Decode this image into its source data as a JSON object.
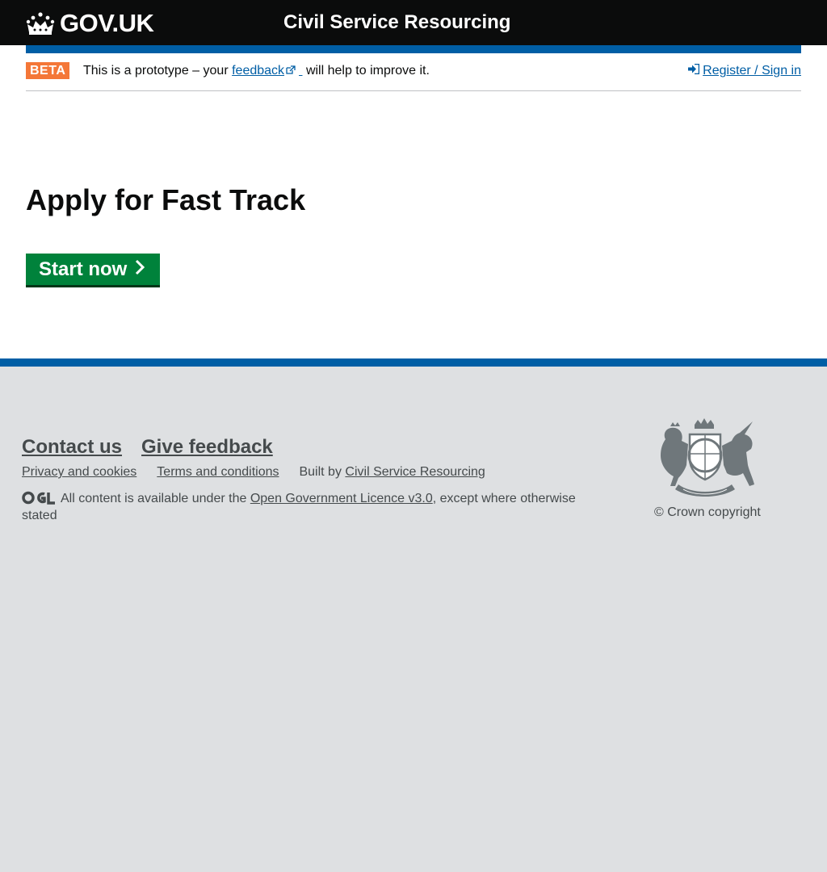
{
  "header": {
    "logo_text": "GOV.UK",
    "service_name": "Civil Service Resourcing"
  },
  "phase_banner": {
    "tag": "BETA",
    "text_before": "This is a prototype – your",
    "link": "feedback",
    "text_after": "will help to improve it.",
    "signin": "Register / Sign in"
  },
  "main": {
    "title": "Apply for Fast Track",
    "start_button": "Start now"
  },
  "footer": {
    "contact": "Contact us",
    "give_feedback": "Give feedback",
    "privacy": "Privacy and cookies",
    "terms": "Terms and conditions",
    "built_by_text": "Built by",
    "built_by_link": "Civil Service Resourcing",
    "licence_before": "All content is available under the",
    "licence_link": "Open Government Licence v3.0",
    "licence_after": ", except where otherwise stated",
    "copyright": "© Crown copyright"
  },
  "colors": {
    "header_bg": "#0b0c0c",
    "brand_blue": "#005ea5",
    "beta_orange": "#f47738",
    "button_green": "#00823b",
    "footer_bg": "#dee0e2",
    "footer_text": "#454a4c"
  },
  "icons": {
    "crown": "crown-icon",
    "external": "external-link-icon",
    "signin": "sign-in-icon",
    "chevron": "chevron-right-icon",
    "ogl": "ogl-logo",
    "crest": "royal-coat-of-arms"
  }
}
